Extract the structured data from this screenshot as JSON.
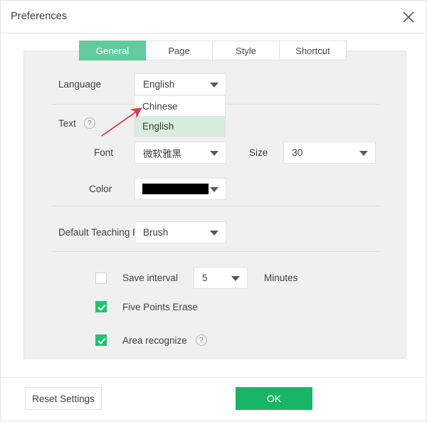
{
  "window": {
    "title": "Preferences",
    "close_icon": "close-icon"
  },
  "tabs": [
    {
      "label": "General",
      "active": true
    },
    {
      "label": "Page",
      "active": false
    },
    {
      "label": "Style",
      "active": false
    },
    {
      "label": "Shortcut",
      "active": false
    }
  ],
  "fields": {
    "language": {
      "label": "Language",
      "value": "English",
      "open": true,
      "options": [
        {
          "label": "Chinese",
          "selected": false
        },
        {
          "label": "English",
          "selected": true
        }
      ]
    },
    "text": {
      "label": "Text",
      "help_icon": "question-mark-icon",
      "help_glyph": "?"
    },
    "font": {
      "label": "Font",
      "value": "微软雅黑"
    },
    "size": {
      "label": "Size",
      "value": "30"
    },
    "color": {
      "label": "Color",
      "value": "#000000"
    },
    "default_teaching_pen": {
      "label": "Default Teaching P",
      "value": "Brush"
    },
    "save_interval": {
      "label": "Save interval",
      "checked": false,
      "value": "5",
      "unit": "Minutes"
    },
    "five_points_erase": {
      "label": "Five Points Erase",
      "checked": true
    },
    "area_recognize": {
      "label": "Area recognize",
      "checked": true,
      "help_icon": "question-mark-icon",
      "help_glyph": "?"
    }
  },
  "footer": {
    "reset_label": "Reset Settings",
    "ok_label": "OK"
  },
  "annotation": {
    "arrow_color": "#d8404a"
  },
  "colors": {
    "accent_green": "#62ca9d",
    "ok_green": "#18b765",
    "checkbox_green": "#22c173",
    "highlight_green": "#d8ece0",
    "card_bg": "#f0f0f0"
  }
}
